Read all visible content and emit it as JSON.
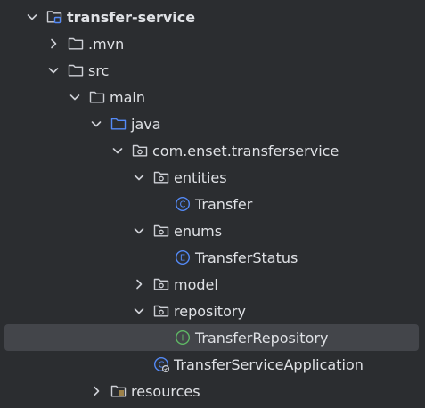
{
  "tree": {
    "items": [
      {
        "label": "transfer-service",
        "depth": 0,
        "expanded": true,
        "icon": "project-folder-icon",
        "bold": true
      },
      {
        "label": ".mvn",
        "depth": 1,
        "expanded": false,
        "icon": "folder-icon"
      },
      {
        "label": "src",
        "depth": 1,
        "expanded": true,
        "icon": "folder-icon"
      },
      {
        "label": "main",
        "depth": 2,
        "expanded": true,
        "icon": "folder-icon"
      },
      {
        "label": "java",
        "depth": 3,
        "expanded": true,
        "icon": "source-folder-icon"
      },
      {
        "label": "com.enset.transferservice",
        "depth": 4,
        "expanded": true,
        "icon": "package-icon"
      },
      {
        "label": "entities",
        "depth": 5,
        "expanded": true,
        "icon": "package-icon"
      },
      {
        "label": "Transfer",
        "depth": 6,
        "icon": "class-icon",
        "badge": "C"
      },
      {
        "label": "enums",
        "depth": 5,
        "expanded": true,
        "icon": "package-icon"
      },
      {
        "label": "TransferStatus",
        "depth": 6,
        "icon": "enum-icon",
        "badge": "E"
      },
      {
        "label": "model",
        "depth": 5,
        "expanded": false,
        "icon": "package-icon"
      },
      {
        "label": "repository",
        "depth": 5,
        "expanded": true,
        "icon": "package-icon"
      },
      {
        "label": "TransferRepository",
        "depth": 6,
        "icon": "interface-icon",
        "badge": "I",
        "selected": true
      },
      {
        "label": "TransferServiceApplication",
        "depth": 5,
        "icon": "spring-class-icon",
        "badge": "C"
      },
      {
        "label": "resources",
        "depth": 3,
        "expanded": false,
        "icon": "resources-folder-icon"
      }
    ]
  },
  "colors": {
    "background": "#2b2d30",
    "selection": "#43454a",
    "text": "#dfe1e5",
    "icon_gray": "#ced0d6",
    "class_blue": "#548af7",
    "interface_green": "#5fb865",
    "source_folder_blue": "#548af7"
  }
}
